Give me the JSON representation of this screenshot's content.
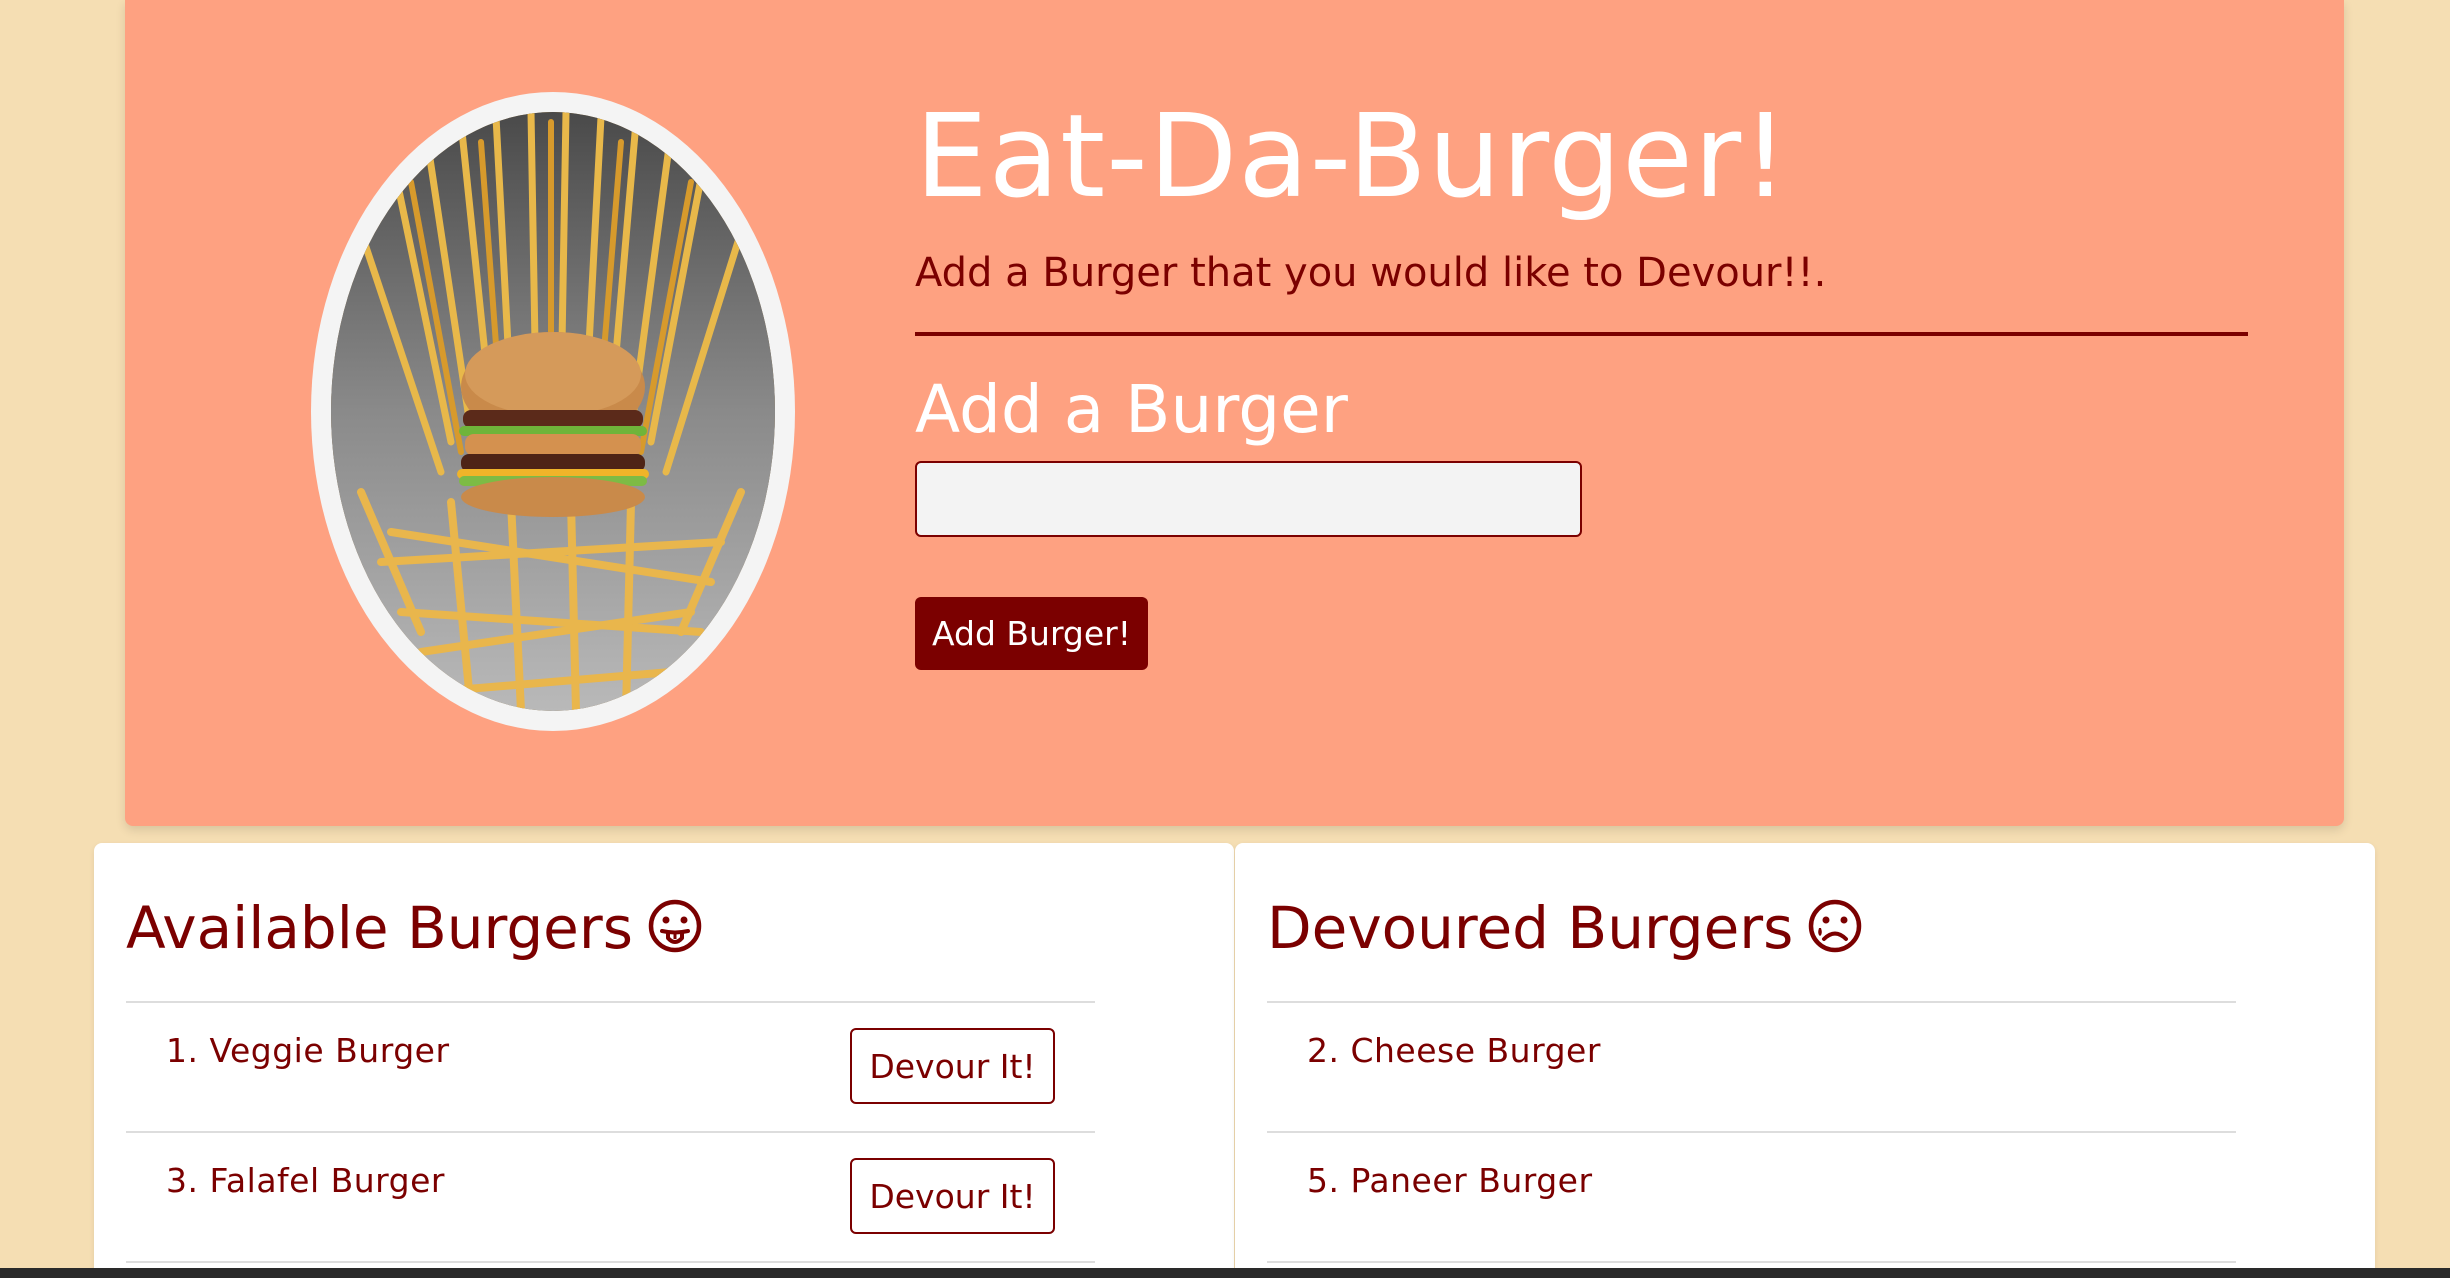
{
  "header": {
    "title": "Eat-Da-Burger!",
    "subtitle": "Add a Burger that you would like to Devour!!.",
    "add_heading": "Add a Burger",
    "input_value": "",
    "input_placeholder": "",
    "add_button_label": "Add Burger!",
    "image_alt": "burger-on-fry-throne"
  },
  "available": {
    "title": "Available Burgers",
    "icon": "tongue-face-icon",
    "items": [
      {
        "label": "1. Veggie Burger",
        "button_label": "Devour It!"
      },
      {
        "label": "3. Falafel Burger",
        "button_label": "Devour It!"
      }
    ]
  },
  "devoured": {
    "title": "Devoured Burgers",
    "icon": "sad-face-icon",
    "items": [
      {
        "label": "2. Cheese Burger"
      },
      {
        "label": "5. Paneer Burger"
      }
    ]
  },
  "colors": {
    "page_background": "#f5deb3",
    "jumbotron": "#fea181",
    "accent": "#7b0000",
    "card": "#ffffff"
  }
}
